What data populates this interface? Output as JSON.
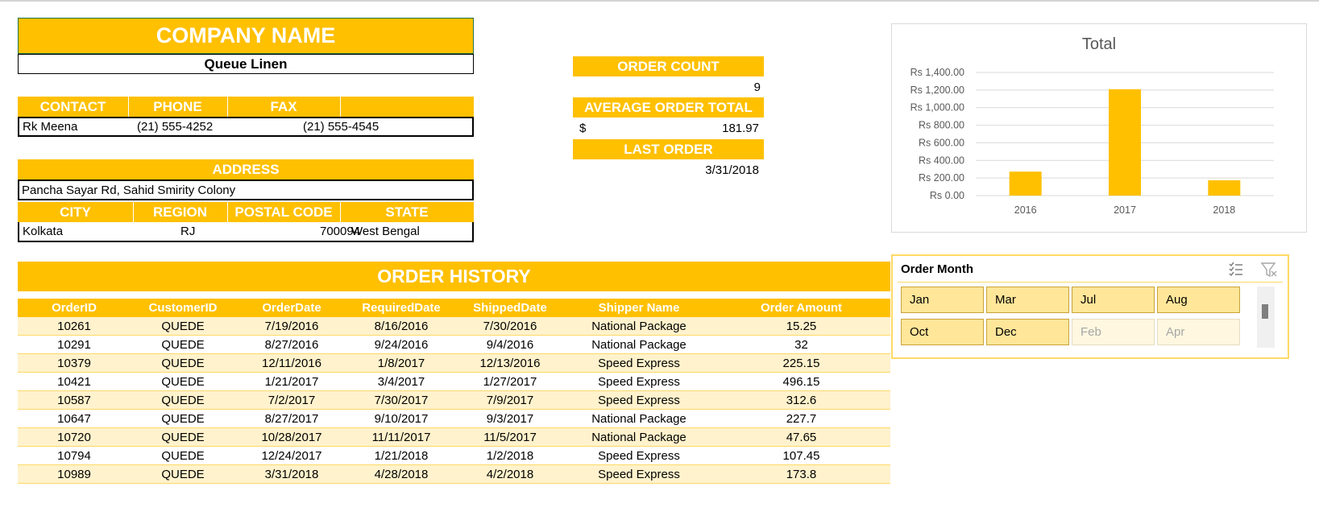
{
  "company": {
    "title": "COMPANY NAME",
    "name": "Queue Linen"
  },
  "contact": {
    "headers": [
      "CONTACT",
      "PHONE",
      "FAX"
    ],
    "contact": "Rk Meena",
    "phone": "(21) 555-4252",
    "fax": "(21) 555-4545"
  },
  "address": {
    "header": "ADDRESS",
    "value": "Pancha Sayar Rd, Sahid Smirity Colony",
    "headers": [
      "CITY",
      "REGION",
      "POSTAL CODE",
      "STATE"
    ],
    "city": "Kolkata",
    "region": "RJ",
    "postal_code": "700094",
    "state": "West Bengal"
  },
  "summary": {
    "order_count_label": "ORDER COUNT",
    "order_count": "9",
    "avg_label": "AVERAGE ORDER TOTAL",
    "avg_currency": "$",
    "avg_value": "181.97",
    "last_label": "LAST ORDER",
    "last_value": "3/31/2018"
  },
  "history": {
    "title": "ORDER HISTORY",
    "columns": [
      "OrderID",
      "CustomerID",
      "OrderDate",
      "RequiredDate",
      "ShippedDate",
      "Shipper Name",
      "Order Amount"
    ],
    "rows": [
      [
        "10261",
        "QUEDE",
        "7/19/2016",
        "8/16/2016",
        "7/30/2016",
        "National Package",
        "15.25"
      ],
      [
        "10291",
        "QUEDE",
        "8/27/2016",
        "9/24/2016",
        "9/4/2016",
        "National Package",
        "32"
      ],
      [
        "10379",
        "QUEDE",
        "12/11/2016",
        "1/8/2017",
        "12/13/2016",
        "Speed Express",
        "225.15"
      ],
      [
        "10421",
        "QUEDE",
        "1/21/2017",
        "3/4/2017",
        "1/27/2017",
        "Speed Express",
        "496.15"
      ],
      [
        "10587",
        "QUEDE",
        "7/2/2017",
        "7/30/2017",
        "7/9/2017",
        "Speed Express",
        "312.6"
      ],
      [
        "10647",
        "QUEDE",
        "8/27/2017",
        "9/10/2017",
        "9/3/2017",
        "National Package",
        "227.7"
      ],
      [
        "10720",
        "QUEDE",
        "10/28/2017",
        "11/11/2017",
        "11/5/2017",
        "National Package",
        "47.65"
      ],
      [
        "10794",
        "QUEDE",
        "12/24/2017",
        "1/21/2018",
        "1/2/2018",
        "Speed Express",
        "107.45"
      ],
      [
        "10989",
        "QUEDE",
        "3/31/2018",
        "4/28/2018",
        "4/2/2018",
        "Speed Express",
        "173.8"
      ]
    ]
  },
  "chart_data": {
    "type": "bar",
    "title": "Total",
    "categories": [
      "2016",
      "2017",
      "2018"
    ],
    "values": [
      272.4,
      1209.05,
      173.8
    ],
    "ylim": [
      0,
      1400
    ],
    "yticks": [
      "Rs 0.00",
      "Rs 200.00",
      "Rs 400.00",
      "Rs 600.00",
      "Rs 800.00",
      "Rs 1,000.00",
      "Rs 1,200.00",
      "Rs 1,400.00"
    ],
    "grid": true,
    "color": "#ffc000"
  },
  "slicer": {
    "title": "Order Month",
    "items": [
      {
        "label": "Jan",
        "selected": true
      },
      {
        "label": "Mar",
        "selected": true
      },
      {
        "label": "Jul",
        "selected": true
      },
      {
        "label": "Aug",
        "selected": true
      },
      {
        "label": "Oct",
        "selected": true
      },
      {
        "label": "Dec",
        "selected": true
      },
      {
        "label": "Feb",
        "selected": false
      },
      {
        "label": "Apr",
        "selected": false
      }
    ],
    "icons": [
      "multi-select-icon",
      "clear-filter-icon"
    ]
  }
}
